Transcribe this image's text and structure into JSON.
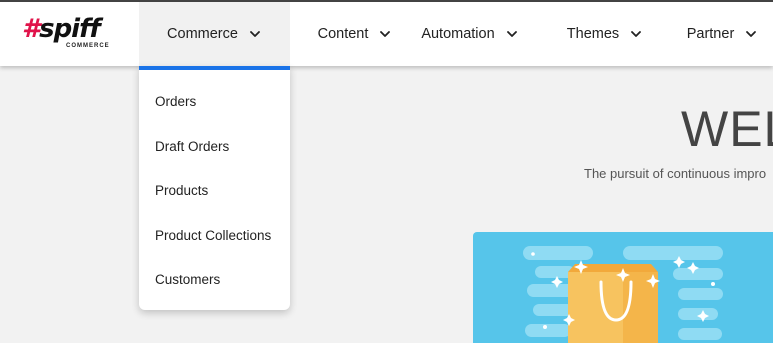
{
  "brand": {
    "logo_text": "#spiff",
    "logo_sub": "COMMERCE",
    "hash_color": "#e0134a"
  },
  "nav": {
    "items": [
      {
        "label": "Commerce",
        "active": true
      },
      {
        "label": "Content"
      },
      {
        "label": "Automation"
      },
      {
        "label": "Themes"
      },
      {
        "label": "Partner"
      }
    ],
    "chevron_icon": "chevron-down-icon"
  },
  "dropdown": {
    "accent_color": "#1a73e8",
    "items": [
      "Orders",
      "Draft Orders",
      "Products",
      "Product Collections",
      "Customers"
    ]
  },
  "hero": {
    "title": "WEL",
    "subtitle": "The pursuit of continuous impro"
  },
  "illustration": {
    "icon": "shopping-bag-icon",
    "bg_color": "#56c5ea",
    "bag_color": "#f7c35f"
  }
}
